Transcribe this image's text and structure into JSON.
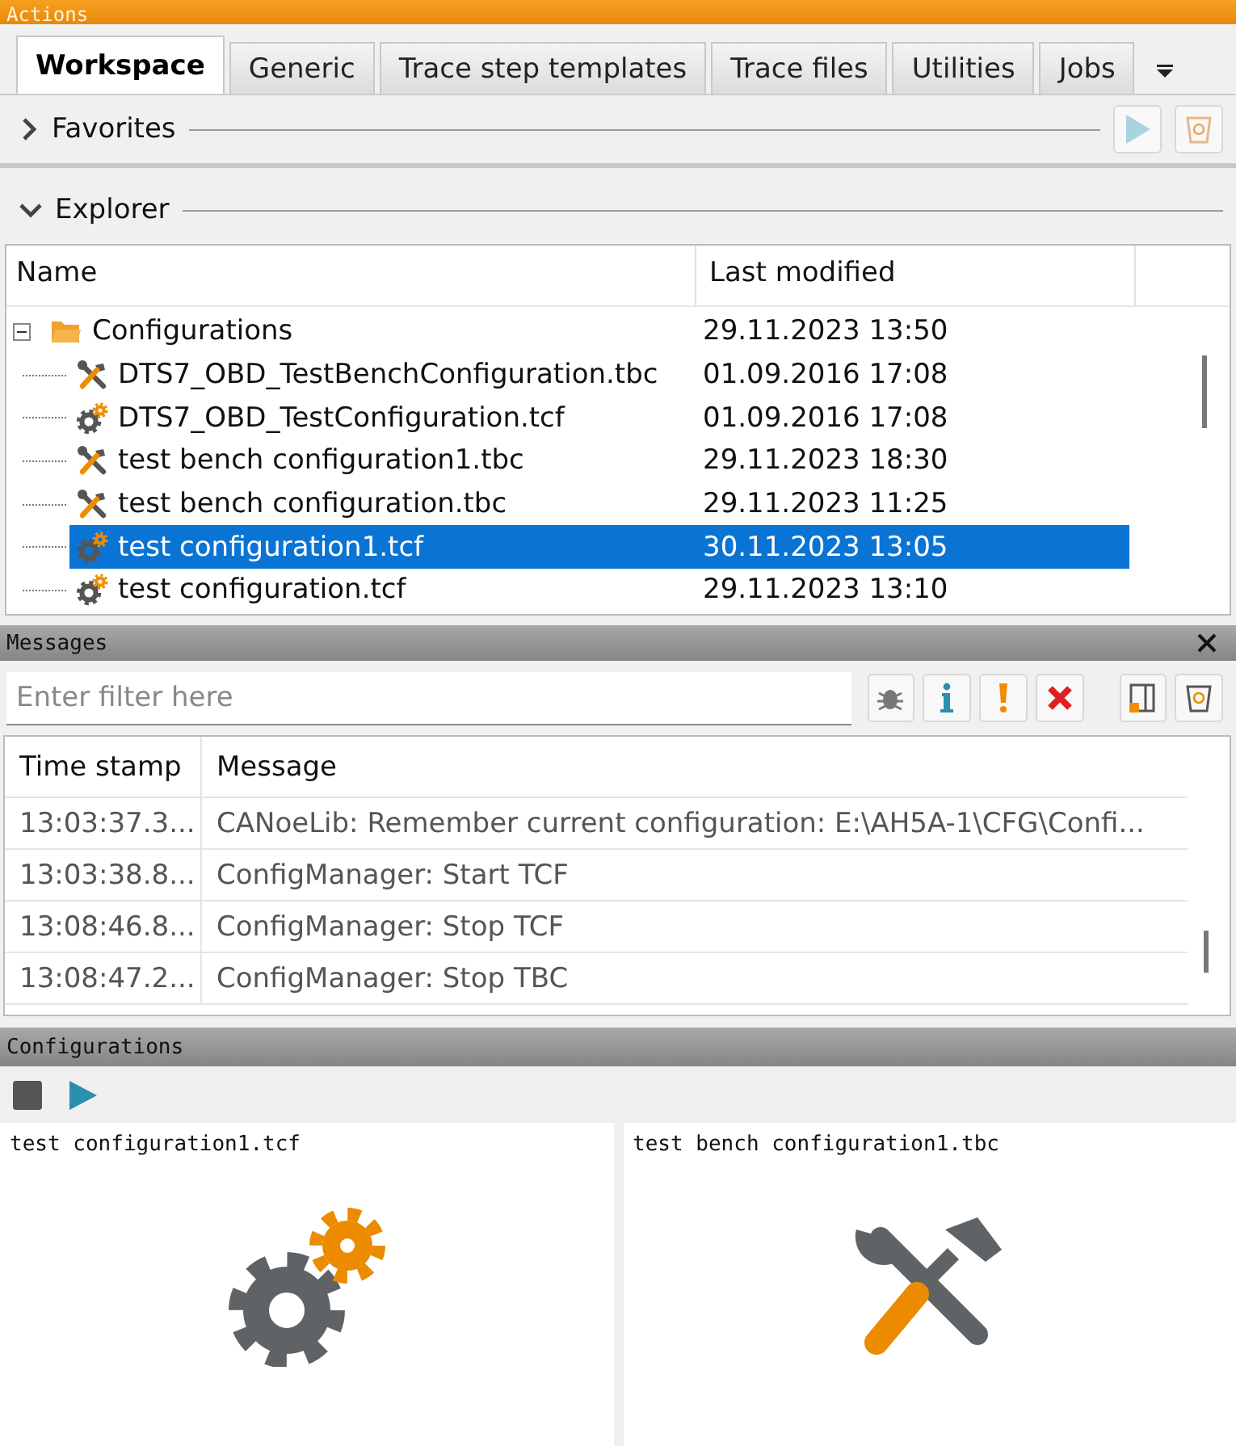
{
  "window": {
    "title": "Actions"
  },
  "tabs": [
    {
      "label": "Workspace",
      "selected": true
    },
    {
      "label": "Generic",
      "selected": false
    },
    {
      "label": "Trace step templates",
      "selected": false
    },
    {
      "label": "Trace files",
      "selected": false
    },
    {
      "label": "Utilities",
      "selected": false
    },
    {
      "label": "Jobs",
      "selected": false
    }
  ],
  "favorites": {
    "title": "Favorites",
    "expanded": false
  },
  "explorer": {
    "title": "Explorer",
    "expanded": true,
    "columns": [
      "Name",
      "Last modified"
    ],
    "tree": [
      {
        "kind": "folder",
        "name": "Configurations",
        "modified": "29.11.2023 13:50",
        "expanded": true,
        "selected": false,
        "children": [
          {
            "kind": "tbc",
            "name": "DTS7_OBD_TestBenchConfiguration.tbc",
            "modified": "01.09.2016 17:08",
            "selected": false
          },
          {
            "kind": "tcf",
            "name": "DTS7_OBD_TestConfiguration.tcf",
            "modified": "01.09.2016 17:08",
            "selected": false
          },
          {
            "kind": "tbc",
            "name": "test bench configuration1.tbc",
            "modified": "29.11.2023 18:30",
            "selected": false
          },
          {
            "kind": "tbc",
            "name": "test bench configuration.tbc",
            "modified": "29.11.2023 11:25",
            "selected": false
          },
          {
            "kind": "tcf",
            "name": "test configuration1.tcf",
            "modified": "30.11.2023 13:05",
            "selected": true
          },
          {
            "kind": "tcf",
            "name": "test configuration.tcf",
            "modified": "29.11.2023 13:10",
            "selected": false
          }
        ]
      }
    ]
  },
  "messages": {
    "title": "Messages",
    "filter": {
      "placeholder": "Enter filter here"
    },
    "columns": [
      "Time stamp",
      "Message"
    ],
    "rows": [
      {
        "time": "13:03:37.3...",
        "message": "CANoeLib: Remember current configuration: E:\\AH5A-1\\CFG\\Confi..."
      },
      {
        "time": "13:03:38.8...",
        "message": "ConfigManager: Start TCF"
      },
      {
        "time": "13:08:46.8...",
        "message": "ConfigManager: Stop TCF"
      },
      {
        "time": "13:08:47.2...",
        "message": "ConfigManager: Stop TBC"
      }
    ]
  },
  "configurations": {
    "title": "Configurations",
    "cards": [
      {
        "kind": "tcf",
        "title": "test configuration1.tcf"
      },
      {
        "kind": "tbc",
        "title": "test bench configuration1.tbc"
      }
    ]
  }
}
